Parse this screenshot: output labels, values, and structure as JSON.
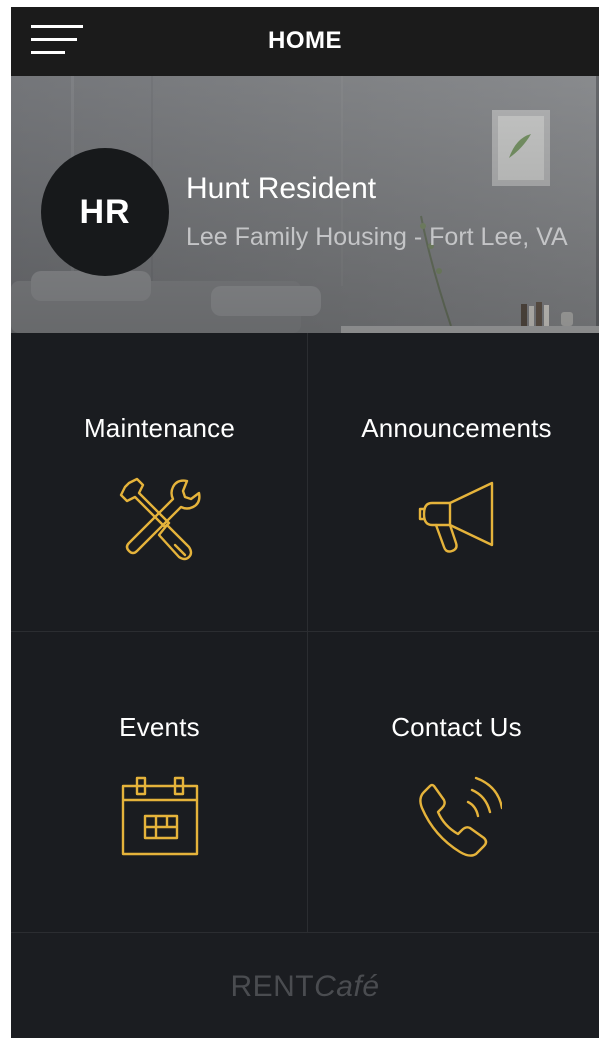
{
  "header": {
    "title": "HOME",
    "menu_icon": "hamburger-menu-icon"
  },
  "profile": {
    "initials": "HR",
    "name": "Hunt Resident",
    "property": "Lee Family Housing - Fort Lee, VA"
  },
  "tiles": [
    {
      "label": "Maintenance",
      "icon": "tools-icon"
    },
    {
      "label": "Announcements",
      "icon": "megaphone-icon"
    },
    {
      "label": "Events",
      "icon": "calendar-icon"
    },
    {
      "label": "Contact Us",
      "icon": "phone-icon"
    }
  ],
  "footer": {
    "brand_primary": "RENT",
    "brand_secondary": "Café"
  },
  "colors": {
    "accent": "#e5b33b",
    "background": "#1a1c20",
    "header": "#1b1b1b",
    "text": "#ffffff"
  }
}
